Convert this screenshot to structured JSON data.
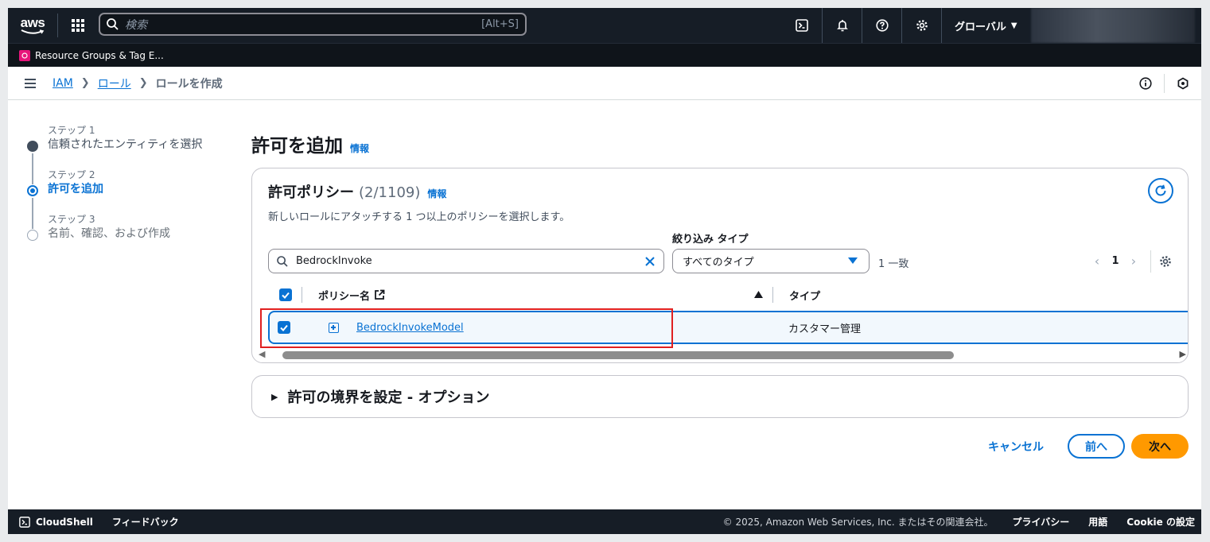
{
  "topnav": {
    "logo_text": "aws",
    "search_placeholder": "検索",
    "search_shortcut": "[Alt+S]",
    "region_label": "グローバル"
  },
  "services_bar": {
    "item_label": "Resource Groups & Tag E..."
  },
  "breadcrumb": {
    "items": [
      "IAM",
      "ロール"
    ],
    "current": "ロールを作成"
  },
  "steps": [
    {
      "label": "ステップ 1",
      "name": "信頼されたエンティティを選択",
      "state": "done"
    },
    {
      "label": "ステップ 2",
      "name": "許可を追加",
      "state": "current"
    },
    {
      "label": "ステップ 3",
      "name": "名前、確認、および作成",
      "state": "todo"
    }
  ],
  "page": {
    "title": "許可を追加",
    "info": "情報"
  },
  "policies": {
    "title": "許可ポリシー",
    "count": "(2/1109)",
    "info": "情報",
    "description": "新しいロールにアタッチする 1 つ以上のポリシーを選択します。",
    "filter_value": "BedrockInvoke",
    "type_filter_label": "絞り込み タイプ",
    "type_filter_value": "すべてのタイプ",
    "match_count": "1 一致",
    "page_number": "1",
    "columns": [
      "ポリシー名",
      "タイプ"
    ],
    "rows": [
      {
        "name": "BedrockInvokeModel",
        "type": "カスタマー管理",
        "selected": true
      }
    ],
    "scroll_thumb_fraction": 0.74
  },
  "boundary": {
    "title": "許可の境界を設定 - オプション"
  },
  "actions": {
    "cancel": "キャンセル",
    "previous": "前へ",
    "next": "次へ"
  },
  "footer": {
    "cloudshell": "CloudShell",
    "feedback": "フィードバック",
    "copyright": "© 2025, Amazon Web Services, Inc. またはその関連会社。",
    "privacy": "プライバシー",
    "terms": "用語",
    "cookies": "Cookie の設定"
  },
  "colors": {
    "nav_bg": "#161d26",
    "link": "#0972d3",
    "primary_button": "#ff9900",
    "highlight_box": "#e02020"
  }
}
